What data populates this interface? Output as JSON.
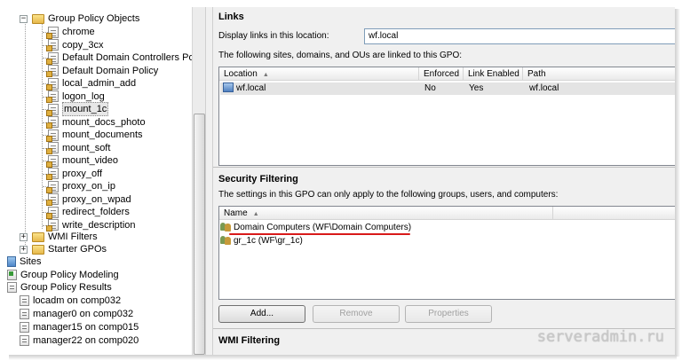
{
  "tree": {
    "root": "Group Policy Objects",
    "gpos": [
      "chrome",
      "copy_3cx",
      "Default Domain Controllers Policy",
      "Default Domain Policy",
      "local_admin_add",
      "logon_log",
      "mount_1c",
      "mount_docs_photo",
      "mount_documents",
      "mount_soft",
      "mount_video",
      "proxy_off",
      "proxy_on_ip",
      "proxy_on_wpad",
      "redirect_folders",
      "write_description"
    ],
    "selected_gpo": "mount_1c",
    "wmi_filters": "WMI Filters",
    "starter_gpos": "Starter GPOs",
    "sites": "Sites",
    "modeling": "Group Policy Modeling",
    "results": "Group Policy Results",
    "result_items": [
      "locadm on comp032",
      "manager0 on comp032",
      "manager15 on comp015",
      "manager22 on comp020"
    ]
  },
  "links": {
    "title": "Links",
    "display_label": "Display links in this location:",
    "display_value": "wf.local",
    "info": "The following sites, domains, and OUs are linked to this GPO:",
    "columns": [
      "Location",
      "Enforced",
      "Link Enabled",
      "Path"
    ],
    "rows": [
      {
        "location": "wf.local",
        "enforced": "No",
        "link_enabled": "Yes",
        "path": "wf.local"
      }
    ]
  },
  "security": {
    "title": "Security Filtering",
    "info": "The settings in this GPO can only apply to the following groups, users, and computers:",
    "column": "Name",
    "rows": [
      "Domain Computers (WF\\Domain Computers)",
      "gr_1c (WF\\gr_1c)"
    ],
    "buttons": {
      "add": "Add...",
      "remove": "Remove",
      "properties": "Properties"
    }
  },
  "wmi": {
    "title": "WMI Filtering"
  },
  "watermark": "serveradmin.ru",
  "colors": {
    "highlight": "#d81a1a"
  }
}
